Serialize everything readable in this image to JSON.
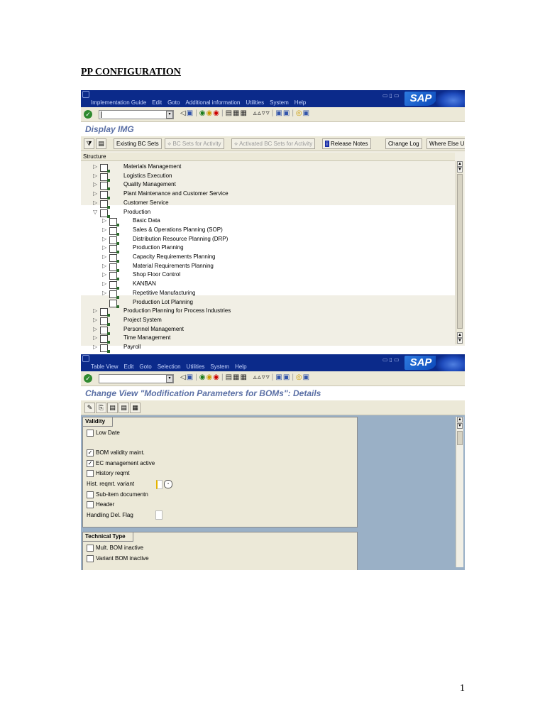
{
  "document": {
    "title": "PP CONFIGURATION",
    "page_number": "1"
  },
  "window1": {
    "menu": [
      "Implementation Guide",
      "Edit",
      "Goto",
      "Additional information",
      "Utilities",
      "System",
      "Help"
    ],
    "logo": "SAP",
    "screen_title": "Display IMG",
    "app_buttons": {
      "existing_bc_sets": "Existing BC Sets",
      "bc_sets_for_activity": "BC Sets for Activity",
      "activated_bc_sets": "Activated BC Sets for Activity",
      "release_notes": "Release Notes",
      "change_log": "Change Log",
      "where_else": "Where Else U"
    },
    "structure_label": "Structure",
    "tree": [
      {
        "label": "Materials Management",
        "level": 0,
        "expanded": false
      },
      {
        "label": "Logistics Execution",
        "level": 0,
        "expanded": false
      },
      {
        "label": "Quality Management",
        "level": 0,
        "expanded": false
      },
      {
        "label": "Plant Maintenance and Customer Service",
        "level": 0,
        "expanded": false
      },
      {
        "label": "Customer Service",
        "level": 0,
        "expanded": false
      },
      {
        "label": "Production",
        "level": 0,
        "expanded": true
      },
      {
        "label": "Basic Data",
        "level": 1,
        "expanded": false
      },
      {
        "label": "Sales & Operations Planning (SOP)",
        "level": 1,
        "expanded": false
      },
      {
        "label": "Distribution Resource Planning (DRP)",
        "level": 1,
        "expanded": false
      },
      {
        "label": "Production Planning",
        "level": 1,
        "expanded": false
      },
      {
        "label": "Capacity Requirements Planning",
        "level": 1,
        "expanded": false
      },
      {
        "label": "Material Requirements Planning",
        "level": 1,
        "expanded": false
      },
      {
        "label": "Shop Floor Control",
        "level": 1,
        "expanded": false
      },
      {
        "label": "KANBAN",
        "level": 1,
        "expanded": false
      },
      {
        "label": "Repetitive Manufacturing",
        "level": 1,
        "expanded": false
      },
      {
        "label": "Production Lot Planning",
        "level": 1,
        "leaf": true
      },
      {
        "label": "Production Planning for Process Industries",
        "level": 0,
        "expanded": false
      },
      {
        "label": "Project System",
        "level": 0,
        "expanded": false
      },
      {
        "label": "Personnel Management",
        "level": 0,
        "expanded": false
      },
      {
        "label": "Time Management",
        "level": 0,
        "expanded": false
      },
      {
        "label": "Payroll",
        "level": 0,
        "expanded": false
      }
    ]
  },
  "window2": {
    "menu": [
      "Table View",
      "Edit",
      "Goto",
      "Selection",
      "Utilities",
      "System",
      "Help"
    ],
    "logo": "SAP",
    "screen_title": "Change View \"Modification Parameters for BOMs\": Details",
    "validity_group": {
      "title": "Validity",
      "low_date": {
        "label": "Low Date",
        "checked": false
      },
      "bom_validity_maint": {
        "label": "BOM validity maint.",
        "checked": true
      },
      "ec_management_active": {
        "label": "EC management active",
        "checked": true
      },
      "history_reqmt": {
        "label": "History reqmt",
        "checked": false
      },
      "hist_reqmt_variant": {
        "label": "Hist. reqmt. variant",
        "value": ""
      },
      "sub_item_documentn": {
        "label": "Sub-item documentn",
        "checked": false
      },
      "header": {
        "label": "Header",
        "checked": false
      },
      "handling_del_flag": {
        "label": "Handling Del. Flag",
        "value": ""
      }
    },
    "technical_type_group": {
      "title": "Technical Type",
      "mult_bom_inactive": {
        "label": "Mult. BOM inactive",
        "checked": false
      },
      "variant_bom_inactive": {
        "label": "Variant BOM inactive",
        "checked": false
      }
    }
  },
  "colors": {
    "menubar": "#0b2a8a",
    "toolbar": "#ece9d8",
    "screen_title": "#5a6fa5",
    "detail_background": "#9ab0c6"
  }
}
